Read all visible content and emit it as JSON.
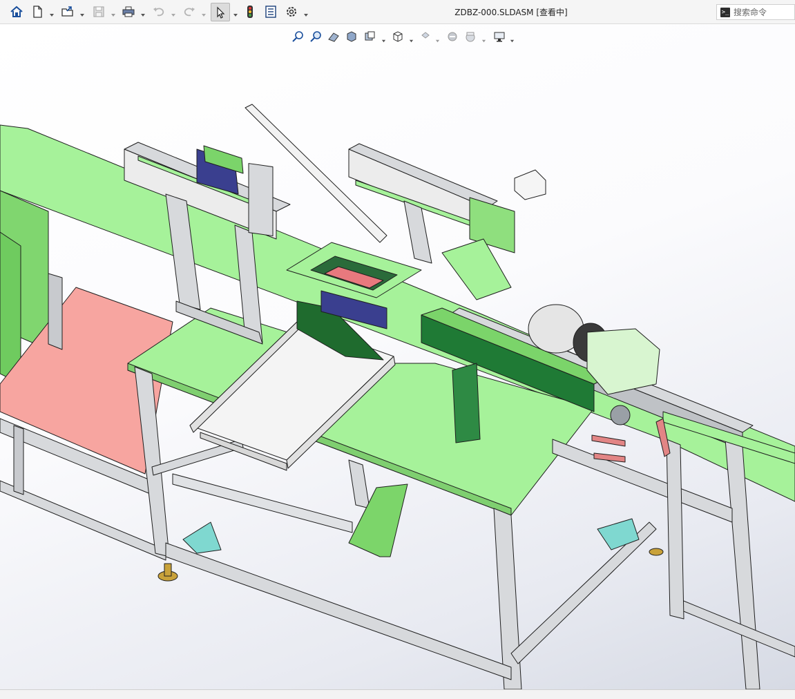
{
  "window": {
    "document_title": "ZDBZ-000.SLDASM [查看中]"
  },
  "toolbar": {
    "items": [
      {
        "name": "home-icon"
      },
      {
        "name": "new-document-icon"
      },
      {
        "name": "open-folder-icon"
      },
      {
        "name": "save-icon"
      },
      {
        "name": "print-icon"
      },
      {
        "name": "undo-icon"
      },
      {
        "name": "redo-icon"
      },
      {
        "name": "select-pointer-icon"
      },
      {
        "name": "rebuild-traffic-light-icon"
      },
      {
        "name": "file-properties-icon"
      },
      {
        "name": "options-gear-icon"
      }
    ]
  },
  "search": {
    "placeholder": "搜索命令",
    "prompt_glyph": ">_"
  },
  "heads_up_view_toolbar": {
    "items": [
      {
        "name": "zoom-to-fit-icon"
      },
      {
        "name": "zoom-to-area-icon"
      },
      {
        "name": "previous-view-icon"
      },
      {
        "name": "section-view-icon"
      },
      {
        "name": "dynamic-annotation-icon"
      },
      {
        "name": "view-orientation-icon"
      },
      {
        "name": "display-style-icon"
      },
      {
        "name": "hide-show-items-icon"
      },
      {
        "name": "edit-appearance-icon"
      },
      {
        "name": "apply-scene-icon"
      },
      {
        "name": "view-settings-monitor-icon"
      }
    ]
  },
  "colors": {
    "toolbar_bg": "#f5f5f5",
    "light_green": "#a6f29a",
    "mid_green": "#8fe07f",
    "dark_green": "#1f6b2e",
    "aluminum": "#d7d9dc",
    "salmon": "#f5a19b",
    "teal": "#7fd8d0",
    "navy": "#3a3f8f",
    "gold": "#c9a23a",
    "white_part": "#f2f2f2"
  }
}
